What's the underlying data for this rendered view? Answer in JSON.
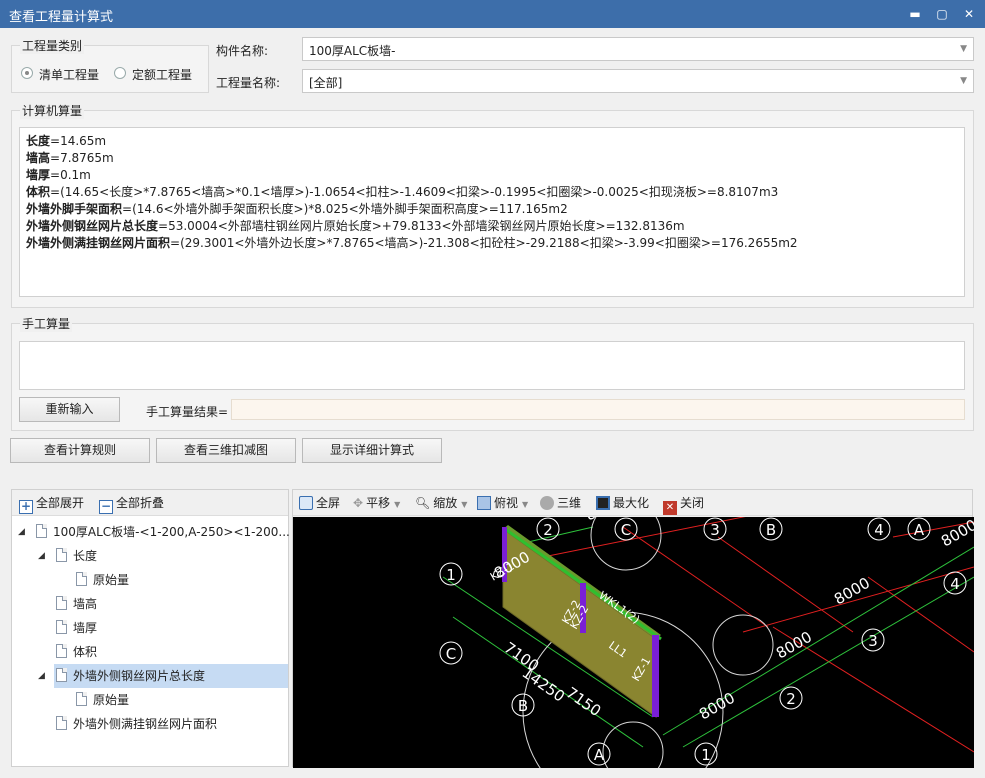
{
  "window": {
    "title": "查看工程量计算式",
    "controls": {
      "minimize": "▬",
      "maximize": "▢",
      "close": "✕"
    }
  },
  "quantity_category": {
    "label": "工程量类别",
    "options": [
      {
        "label": "清单工程量",
        "checked": true
      },
      {
        "label": "定额工程量",
        "checked": false
      }
    ]
  },
  "component_name": {
    "label": "构件名称:",
    "value": "100厚ALC板墙-"
  },
  "quantity_name": {
    "label": "工程量名称:",
    "value": "[全部]"
  },
  "computer_calc": {
    "label": "计算机算量",
    "lines": [
      {
        "key": "长度",
        "expr": "=14.65m"
      },
      {
        "key": "墙高",
        "expr": "=7.8765m"
      },
      {
        "key": "墙厚",
        "expr": "=0.1m"
      },
      {
        "key": "体积",
        "expr": "=(14.65<长度>*7.8765<墙高>*0.1<墙厚>)-1.0654<扣柱>-1.4609<扣梁>-0.1995<扣圈梁>-0.0025<扣现浇板>=8.8107m3"
      },
      {
        "key": "外墙外脚手架面积",
        "expr": "=(14.6<外墙外脚手架面积长度>)*8.025<外墙外脚手架面积高度>=117.165m2"
      },
      {
        "key": "外墙外侧钢丝网片总长度",
        "expr": "=53.0004<外部墙柱钢丝网片原始长度>+79.8133<外部墙梁钢丝网片原始长度>=132.8136m"
      },
      {
        "key": "外墙外侧满挂钢丝网片面积",
        "expr": "=(29.3001<外墙外边长度>*7.8765<墙高>)-21.308<扣砼柱>-29.2188<扣梁>-3.99<扣圈梁>=176.2655m2"
      }
    ]
  },
  "manual_calc": {
    "label": "手工算量",
    "reinput_button": "重新输入",
    "result_label": "手工算量结果="
  },
  "buttons": {
    "view_rules": "查看计算规则",
    "view_3d": "查看三维扣减图",
    "show_detail": "显示详细计算式"
  },
  "tree_toolbar": {
    "expand_all": "全部展开",
    "collapse_all": "全部折叠"
  },
  "tree": {
    "root": "100厚ALC板墙-<1-200,A-250><1-200...",
    "length": "长度",
    "length_original": "原始量",
    "height": "墙高",
    "thickness": "墙厚",
    "volume": "体积",
    "mesh_length": "外墙外侧钢丝网片总长度",
    "mesh_length_original": "原始量",
    "mesh_area": "外墙外侧满挂钢丝网片面积"
  },
  "view_toolbar": {
    "fullscreen": "全屏",
    "pan": "平移",
    "zoom": "缩放",
    "top_view": "俯视",
    "three_d": "三维",
    "maximize": "最大化",
    "close": "关闭"
  },
  "scene": {
    "dims": [
      "8000",
      "8000",
      "8000",
      "8000",
      "7100",
      "14250",
      "7150",
      "8000",
      "8000"
    ],
    "members": [
      "KZ-1",
      "KZ-2",
      "KZ-2",
      "KZ-1",
      "WKL1(2)",
      "LL1"
    ],
    "axes": [
      "1",
      "2",
      "C",
      "3",
      "B",
      "4",
      "A",
      "4",
      "3",
      "2",
      "1",
      "A",
      "B",
      "C",
      "1"
    ]
  },
  "colors": {
    "titlebar": "#3d6eaa",
    "tree_selected": "#c6dbf3",
    "wall": "#8a8530",
    "grid_red": "#e02020",
    "grid_green": "#2ec23c"
  }
}
